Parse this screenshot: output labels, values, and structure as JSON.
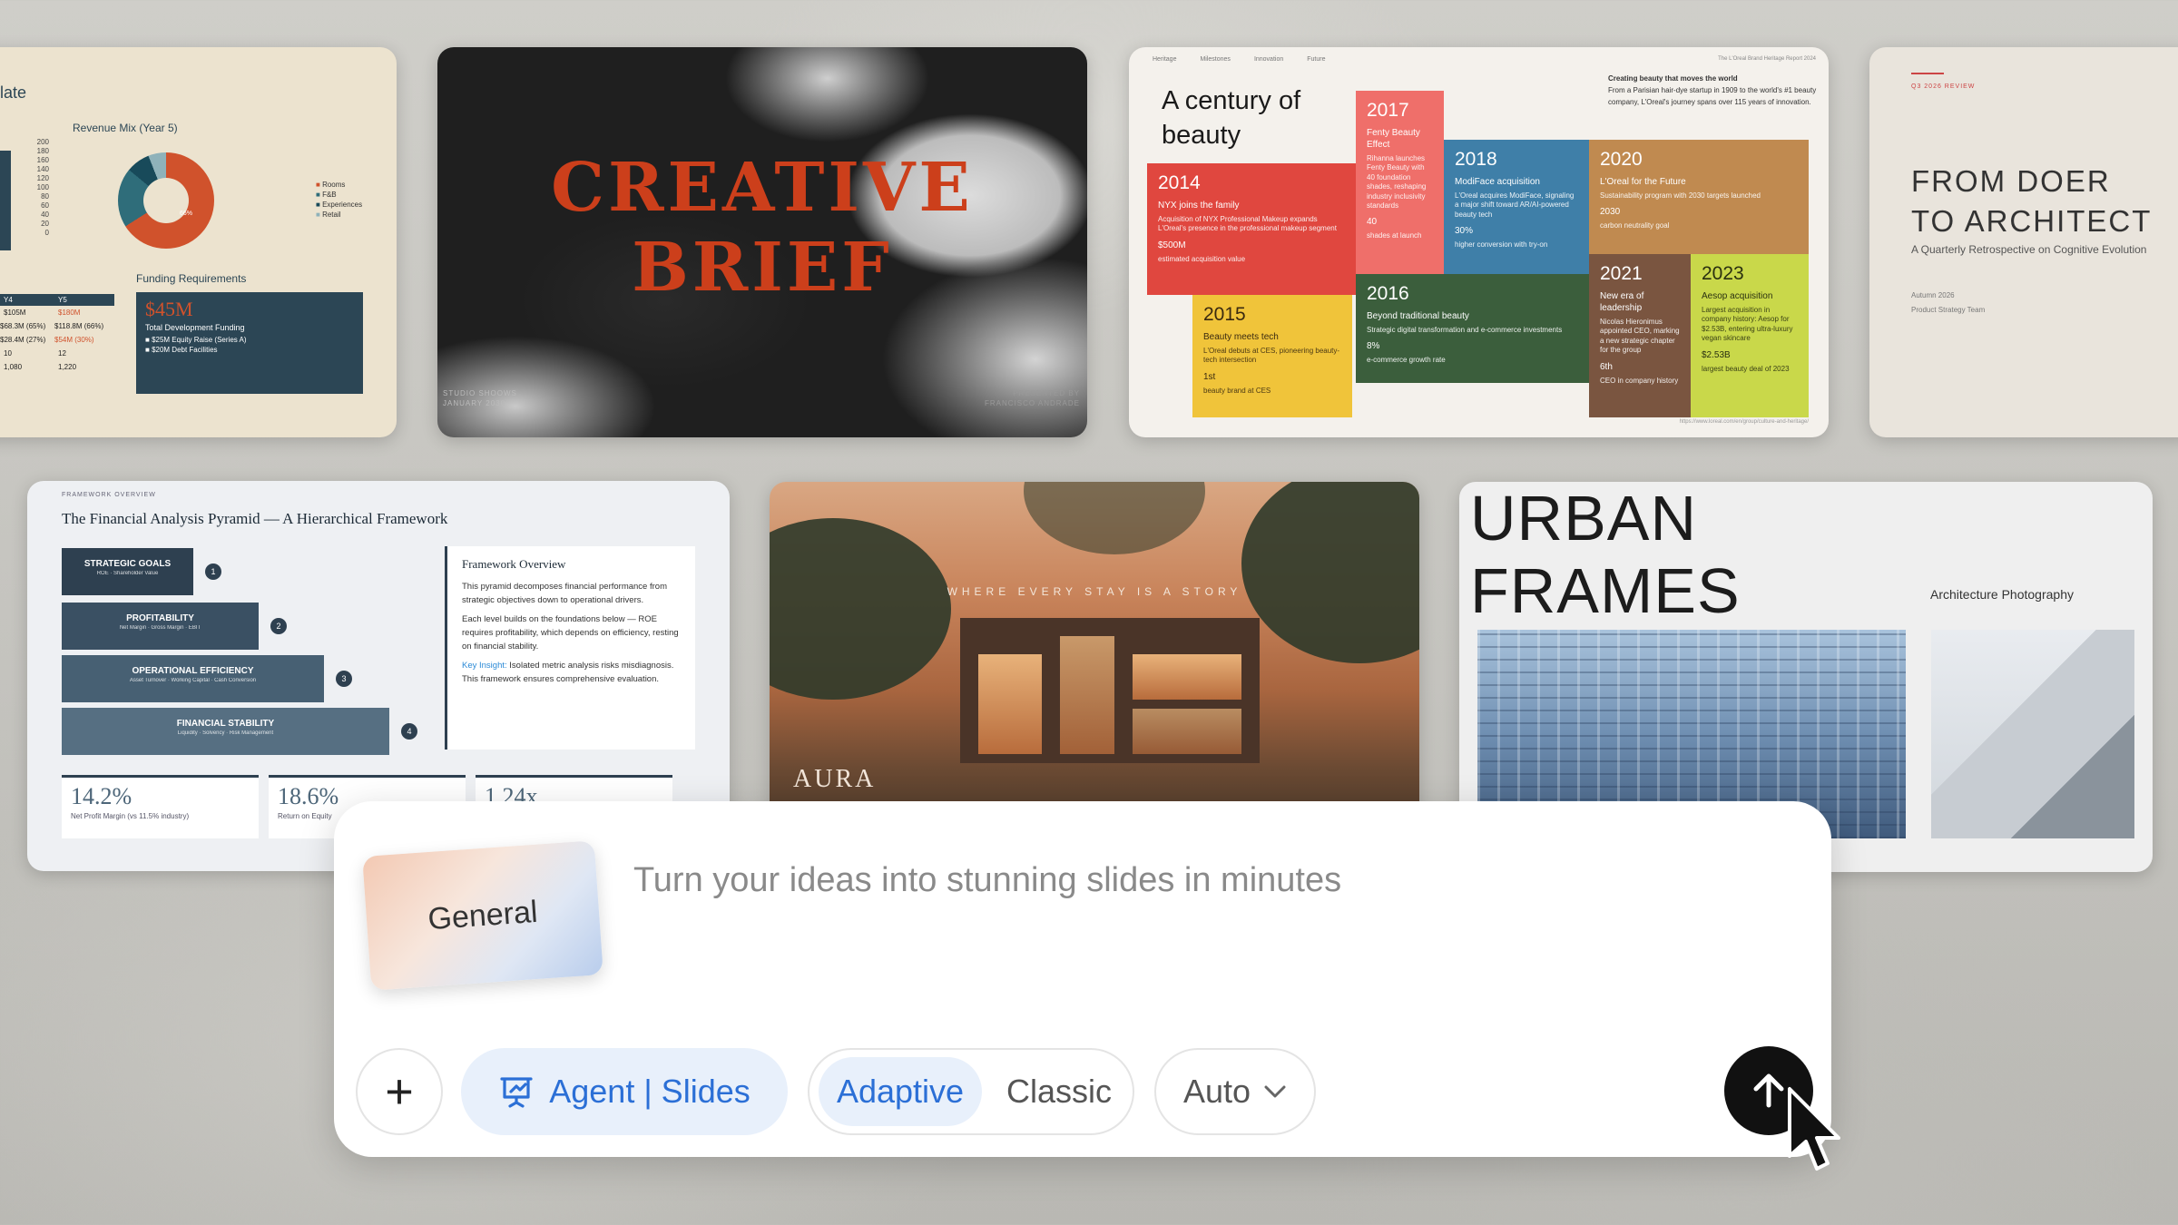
{
  "cards": {
    "hotel": {
      "partial_title": "late",
      "chart_title": "Revenue Mix (Year 5)",
      "y_ticks": [
        "200",
        "180",
        "160",
        "140",
        "120",
        "100",
        "80",
        "60",
        "40",
        "20",
        "0"
      ],
      "legend": [
        "Rooms",
        "F&B",
        "Experiences",
        "Retail"
      ],
      "donut_label": "66%",
      "funding_title": "Funding Requirements",
      "funding_amount": "$45M",
      "funding_sub": "Total Development Funding",
      "funding_items": [
        "$25M Equity Raise (Series A)",
        "$20M Debt Facilities"
      ],
      "table_headers": [
        "Y4",
        "Y5"
      ],
      "table_rows": [
        [
          "$105M",
          "$180M"
        ],
        [
          "$68.3M (65%)",
          "$118.8M (66%)"
        ],
        [
          "$28.4M (27%)",
          "$54M (30%)"
        ],
        [
          "10",
          "12"
        ],
        [
          "1,080",
          "1,220"
        ]
      ]
    },
    "brief": {
      "title_line1": "CREATIVE",
      "title_line2": "BRIEF",
      "studio": "STUDIO SHOOWS",
      "date": "JANUARY 2030",
      "presented_label": "PRESENTED BY",
      "presenter": "FRANCISCO ANDRADE"
    },
    "timeline": {
      "nav": [
        "Heritage",
        "Milestones",
        "Innovation",
        "Future"
      ],
      "report": "The L'Oreal Brand Heritage Report 2024",
      "title": "A century of beauty",
      "intro_title": "Creating beauty that moves the world",
      "intro_text": "From a Parisian hair-dye startup in 1909 to the world's #1 beauty company, L'Oreal's journey spans over 115 years of innovation.",
      "blocks": [
        {
          "year": "2014",
          "title": "NYX joins the family",
          "text": "Acquisition of NYX Professional Makeup expands L'Oreal's presence in the professional makeup segment",
          "stat": "$500M",
          "stat_label": "estimated acquisition value",
          "color": "#e0473f"
        },
        {
          "year": "2017",
          "title": "Fenty Beauty Effect",
          "text": "Rihanna launches Fenty Beauty with 40 foundation shades, reshaping industry inclusivity standards",
          "stat": "40",
          "stat_label": "shades at launch",
          "color": "#ef6f6a"
        },
        {
          "year": "2018",
          "title": "ModiFace acquisition",
          "text": "L'Oreal acquires ModiFace, signaling a major shift toward AR/AI-powered beauty tech",
          "stat": "30%",
          "stat_label": "higher conversion with try-on",
          "color": "#3f7fa8"
        },
        {
          "year": "2020",
          "title": "L'Oreal for the Future",
          "text": "Sustainability program with 2030 targets launched",
          "stat": "2030",
          "stat_label": "carbon neutrality goal",
          "color": "#c08a50"
        },
        {
          "year": "2015",
          "title": "Beauty meets tech",
          "text": "L'Oreal debuts at CES, pioneering beauty-tech intersection",
          "stat": "1st",
          "stat_label": "beauty brand at CES",
          "color": "#f0c43a"
        },
        {
          "year": "2016",
          "title": "Beyond traditional beauty",
          "text": "Strategic digital transformation and e-commerce investments",
          "stat": "8%",
          "stat_label": "e-commerce growth rate",
          "color": "#3b5e3c"
        },
        {
          "year": "2021",
          "title": "New era of leadership",
          "text": "Nicolas Hieronimus appointed CEO, marking a new strategic chapter for the group",
          "stat": "6th",
          "stat_label": "CEO in company history",
          "color": "#7a5540"
        },
        {
          "year": "2023",
          "title": "Aesop acquisition",
          "text": "Largest acquisition in company history: Aesop for $2.53B, entering ultra-luxury vegan skincare",
          "stat": "$2.53B",
          "stat_label": "largest beauty deal of 2023",
          "color": "#c9d84a"
        }
      ],
      "source": "https://www.loreal.com/en/group/culture-and-heritage/"
    },
    "doer": {
      "eyebrow": "Q3 2026 REVIEW",
      "title_line1": "FROM DOER",
      "title_line2": "TO ARCHITECT",
      "subtitle": "A Quarterly Retrospective on Cognitive Evolution",
      "date": "Autumn 2026",
      "team": "Product Strategy Team"
    },
    "pyramid": {
      "eyebrow": "FRAMEWORK OVERVIEW",
      "title": "The Financial Analysis Pyramid — A Hierarchical Framework",
      "levels": [
        {
          "name": "STRATEGIC GOALS",
          "sub": "ROE · Shareholder Value",
          "num": "1"
        },
        {
          "name": "PROFITABILITY",
          "sub": "Net Margin · Gross Margin · EBIT",
          "num": "2"
        },
        {
          "name": "OPERATIONAL EFFICIENCY",
          "sub": "Asset Turnover · Working Capital · Cash Conversion",
          "num": "3"
        },
        {
          "name": "FINANCIAL STABILITY",
          "sub": "Liquidity · Solvency · Risk Management",
          "num": "4"
        }
      ],
      "overview_title": "Framework Overview",
      "overview_p1": "This pyramid decomposes financial performance from strategic objectives down to operational drivers.",
      "overview_p2": "Each level builds on the foundations below — ROE requires profitability, which depends on efficiency, resting on financial stability.",
      "insight_label": "Key Insight:",
      "insight_text": "Isolated metric analysis risks misdiagnosis. This framework ensures comprehensive evaluation.",
      "kpis": [
        {
          "value": "14.2%",
          "label": "Net Profit Margin (vs 11.5% industry)"
        },
        {
          "value": "18.6%",
          "label": "Return on Equity"
        },
        {
          "value": "1.24x",
          "label": ""
        }
      ]
    },
    "aura": {
      "tagline": "WHERE EVERY STAY IS A STORY",
      "brand": "AURA"
    },
    "urban": {
      "title_line1": "URBAN",
      "title_line2": "FRAMES",
      "subtitle": "Architecture Photography"
    }
  },
  "panel": {
    "mode_card_label": "General",
    "prompt_placeholder": "Turn your ideas into stunning slides in minutes",
    "plus_label": "+",
    "agent_label": "Agent | Slides",
    "agent_icon": "presentation-icon",
    "toggle": {
      "adaptive": "Adaptive",
      "classic": "Classic",
      "selected": "Adaptive"
    },
    "auto_label": "Auto",
    "send_icon": "arrow-up-icon",
    "accent_color": "#2b6fd6"
  }
}
